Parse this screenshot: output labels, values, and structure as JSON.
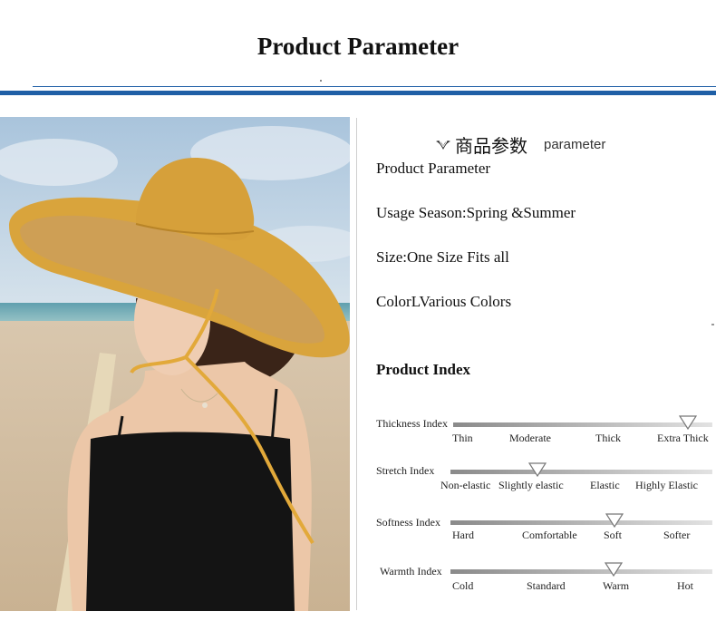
{
  "header": {
    "title": "Product Parameter"
  },
  "params": {
    "cn_heading": "商品参数",
    "cn_sub": "parameter",
    "lines": [
      "Product Parameter",
      "Usage Season:Spring &Summer",
      "Size:One Size Fits all",
      "ColorLVarious Colors"
    ]
  },
  "product_index": {
    "title": "Product Index",
    "rows": [
      {
        "label": "Thickness Index",
        "options": [
          "Thin",
          "Moderate",
          "Thick",
          "Extra Thick"
        ],
        "selected": "Extra Thick"
      },
      {
        "label": "Stretch Index",
        "options": [
          "Non-elastic",
          "Slightly elastic",
          "Elastic",
          "Highly Elastic"
        ],
        "selected": "Slightly elastic"
      },
      {
        "label": "Softness Index",
        "options": [
          "Hard",
          "Comfortable",
          "Soft",
          "Softer"
        ],
        "selected": "Soft"
      },
      {
        "label": "Warmth Index",
        "options": [
          "Cold",
          "Standard",
          "Warm",
          "Hot"
        ],
        "selected": "Warm"
      }
    ]
  },
  "colors": {
    "accent_blue": "#1f5fa6",
    "hat_mustard": "#d9a43c",
    "dress_black": "#141414"
  }
}
